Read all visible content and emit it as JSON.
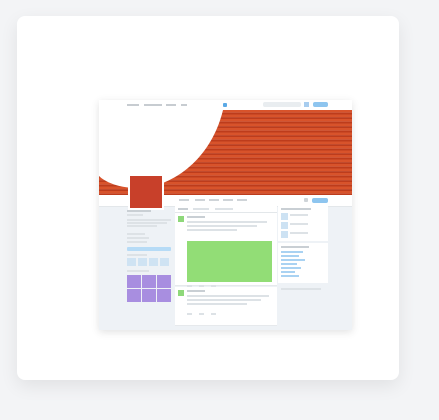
{
  "app": {
    "title": "",
    "description": ""
  },
  "colors": {
    "background": "#f3f4f6",
    "card": "#ffffff",
    "banner_primary": "#d8532b",
    "banner_stripe": "#bd3c1c",
    "profile_picture": "#c8402a",
    "tweet_image": "#92dd76",
    "photo_grid": "#a88ee0",
    "accent_blue": "#8ec5ef"
  },
  "topbar": {
    "nav_items": [
      "",
      "",
      "",
      ""
    ],
    "search_placeholder": "",
    "tweet_button": ""
  },
  "profile_nav": {
    "tabs": [
      "",
      "",
      "",
      "",
      ""
    ],
    "follow_button": ""
  },
  "feed": {
    "tabs": [
      "",
      "",
      ""
    ],
    "tweets": [
      {
        "author": "",
        "text": ""
      },
      {
        "author": "",
        "text": ""
      }
    ]
  },
  "sidebar": {
    "who_to_follow_title": "",
    "suggestions": [
      "",
      "",
      ""
    ],
    "trends_title": "",
    "trends": [
      "",
      "",
      "",
      "",
      "",
      "",
      ""
    ]
  },
  "icons": [
    "twitter-bird-icon",
    "gear-icon",
    "avatar-icon"
  ]
}
